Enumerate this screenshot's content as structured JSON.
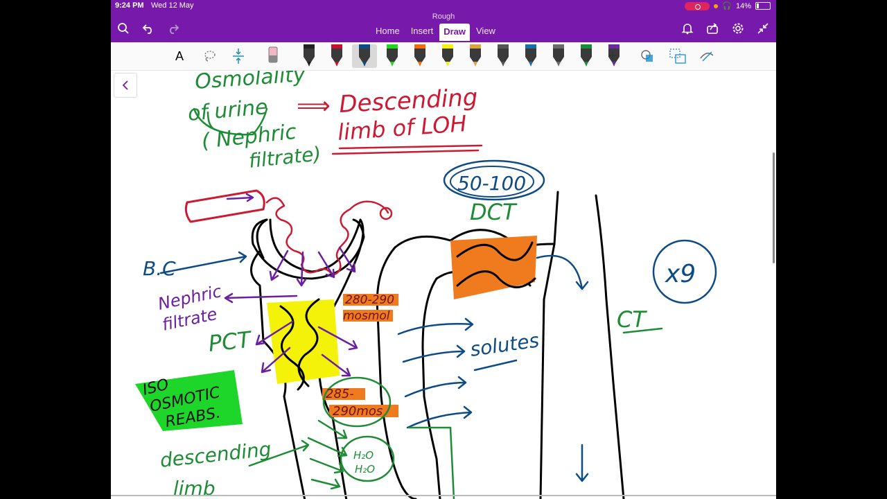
{
  "status": {
    "time": "9:24 PM",
    "date": "Wed 12 May",
    "battery": "14%"
  },
  "app": {
    "doc_title": "Rough"
  },
  "tabs": [
    {
      "label": "Home",
      "active": false
    },
    {
      "label": "Insert",
      "active": false
    },
    {
      "label": "Draw",
      "active": true
    },
    {
      "label": "View",
      "active": false
    }
  ],
  "toolbar": {
    "text_tool": "A",
    "pens": [
      {
        "color": "#222222"
      },
      {
        "color": "#c8102e"
      },
      {
        "color": "#0d4b85"
      },
      {
        "color": "#22d81e"
      },
      {
        "color": "#ef6c0f"
      },
      {
        "color": "#f5f20a"
      },
      {
        "color": "#d9a441"
      },
      {
        "color": "#555555"
      },
      {
        "color": "#1a6fa8"
      },
      {
        "color": "#6a6a6a"
      },
      {
        "color": "#198c3a"
      },
      {
        "color": "#6a2aa0"
      }
    ],
    "add": "+"
  },
  "colors": {
    "accent": "#7719aa",
    "red": "#cc1a33",
    "green": "#1e8c35",
    "navy": "#0d4b85",
    "purple": "#6a1fa0",
    "orange": "#f07a1e",
    "yellow": "#f5f20a",
    "lime": "#1ed62a"
  },
  "ink": {
    "osmolality": "Osmolality",
    "of_urine": "of urine",
    "nephric": "( Nephric",
    "filtrate": "filtrate)",
    "arrow": "⟹",
    "descending_red": "Descending",
    "limb_loh": "limb of LOH",
    "range_50_100": "50-100",
    "dct": "DCT",
    "bc": "B.C",
    "nephric_filtrate": "Nephric",
    "filtrate2": "filtrate",
    "osm_280_290": "280-290",
    "mosmol": "mosmol",
    "pct": "PCT",
    "iso": "ISO",
    "osmotic": "OSMOTIC",
    "reabs": "REABS.",
    "osm_285": "285-",
    "osm_290": "290mos",
    "solutes": "solutes",
    "x9": "x9",
    "ct": "CT",
    "descending_green": "descending",
    "limb_green": "limb",
    "h2o": "H₂O",
    "h2o2": "H₂O"
  }
}
